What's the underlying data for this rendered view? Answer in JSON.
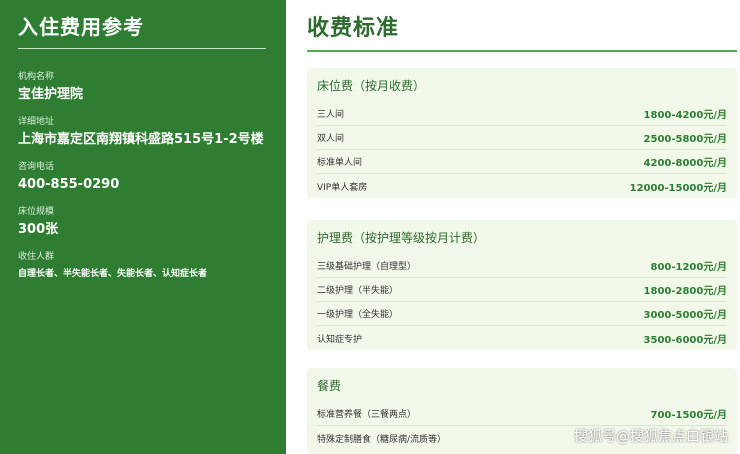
{
  "left": {
    "title": "入住费用参考",
    "items": [
      {
        "label": "机构名称",
        "value": "宝佳护理院"
      },
      {
        "label": "详细地址",
        "value": "上海市嘉定区南翔镇科盛路515号1-2号楼"
      },
      {
        "label": "咨询电话",
        "value": "400-855-0290"
      },
      {
        "label": "床位规模",
        "value": "300张"
      },
      {
        "label": "收住人群",
        "value": "自理长者、半失能长者、失能长者、认知症长者"
      }
    ]
  },
  "right": {
    "title": "收费标准",
    "sections": [
      {
        "title": "床位费（按月收费）",
        "rows": [
          {
            "name": "三人间",
            "price": "1800-4200元/月"
          },
          {
            "name": "双人间",
            "price": "2500-5800元/月"
          },
          {
            "name": "标准单人间",
            "price": "4200-8000元/月"
          },
          {
            "name": "VIP单人套房",
            "price": "12000-15000元/月"
          }
        ]
      },
      {
        "title": "护理费（按护理等级按月计费）",
        "rows": [
          {
            "name": "三级基础护理（自理型）",
            "price": "800-1200元/月"
          },
          {
            "name": "二级护理（半失能）",
            "price": "1800-2800元/月"
          },
          {
            "name": "一级护理（全失能）",
            "price": "3000-5000元/月"
          },
          {
            "name": "认知症专护",
            "price": "3500-6000元/月"
          }
        ]
      },
      {
        "title": "餐费",
        "rows": [
          {
            "name": "标准营养餐（三餐两点）",
            "price": "700-1500元/月"
          },
          {
            "name": "特殊定制膳食（糖尿病/流质等）",
            "price": ""
          }
        ]
      }
    ]
  },
  "watermark": "搜狐号@搜狐焦点白银站",
  "colors": {
    "sidebar_bg": "#2f7d32",
    "title_green": "#2e6b2f",
    "price_green": "#2e7d32",
    "card_bg": "#f1f8ea",
    "accent_line": "#4caf50"
  }
}
